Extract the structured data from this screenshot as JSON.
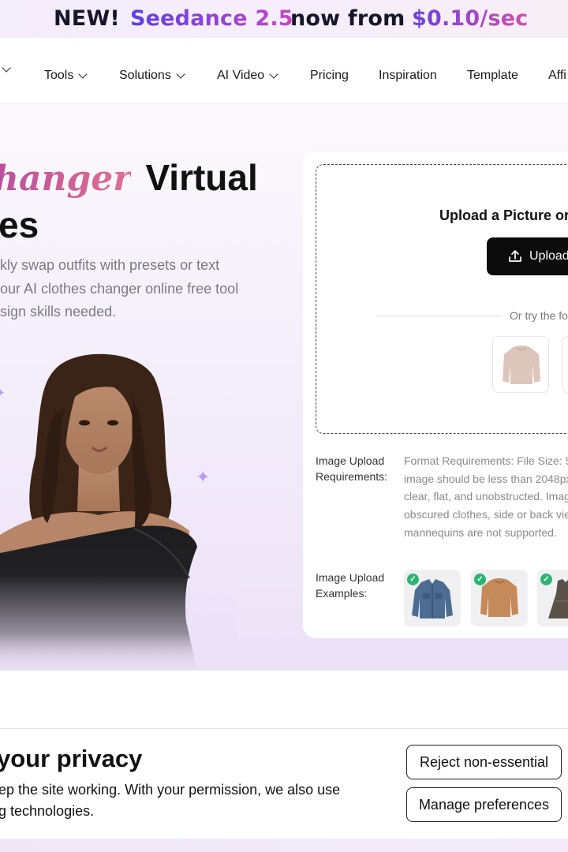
{
  "promo": {
    "new": "NEW!",
    "model": "Seedance 2.5",
    "mid": "now from",
    "price": "$0.10/sec"
  },
  "nav": {
    "items": [
      {
        "label": "Tools"
      },
      {
        "label": "Solutions"
      },
      {
        "label": "AI Video"
      },
      {
        "label": "Pricing"
      },
      {
        "label": "Inspiration"
      },
      {
        "label": "Template"
      },
      {
        "label": "Affi"
      }
    ]
  },
  "hero": {
    "title_script": "hanger",
    "title_word": "Virtual",
    "title_line2": "es",
    "description": [
      "kly swap outfits with presets or text",
      "our AI clothes changer online free tool",
      "sign skills needed."
    ]
  },
  "upload": {
    "title": "Upload a Picture or",
    "button_label": "Upload",
    "try_text": "Or try the fo",
    "requirements_label": [
      "Image Upload",
      "Requirements:"
    ],
    "requirements_text": [
      "Format Requirements: File Size: 5",
      "image should be less than 2048px",
      "clear, flat, and unobstructed. Imag",
      "obscured clothes, side or back vie",
      "mannequins are not supported."
    ],
    "examples_label": [
      "Image Upload",
      "Examples:"
    ]
  },
  "cookie": {
    "title": "your privacy",
    "text": [
      "ep the site working. With your permission, we also use",
      "g technologies."
    ],
    "reject_label": "Reject non-essential",
    "manage_label": "Manage preferences"
  },
  "colors": {
    "accent_purple": "#6d3ee0",
    "accent_pink": "#d14fb0",
    "check_green": "#2bb673"
  }
}
